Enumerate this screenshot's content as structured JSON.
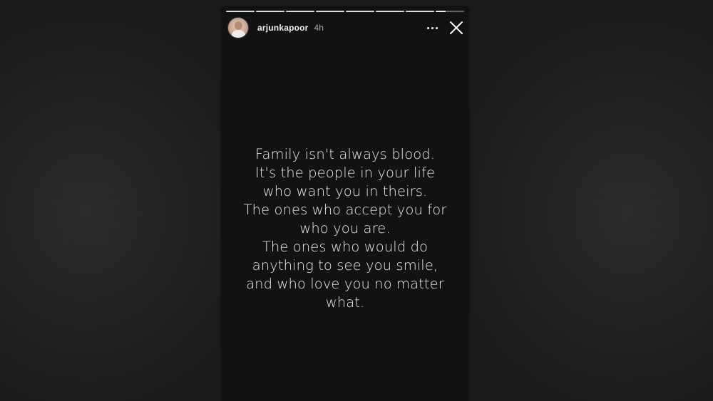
{
  "story": {
    "username": "arjunkapoor",
    "time_ago": "4h",
    "progress": {
      "segments_total": 8,
      "segments_viewed": 7,
      "current_fraction": 0.35
    },
    "quote_lines": [
      "Family isn't always blood.",
      "It's the people in your life",
      "who want you in theirs.",
      "The ones who accept you for",
      "who you are.",
      "The ones who would do",
      "anything to see you smile,",
      "and who love you no matter",
      "what."
    ]
  },
  "icons": {
    "more": "more-horizontal-icon",
    "close": "close-icon"
  },
  "colors": {
    "background": "#1a1a1a",
    "story_background": "#121212",
    "text": "#e9e9e9",
    "muted": "#a8a8a8"
  }
}
